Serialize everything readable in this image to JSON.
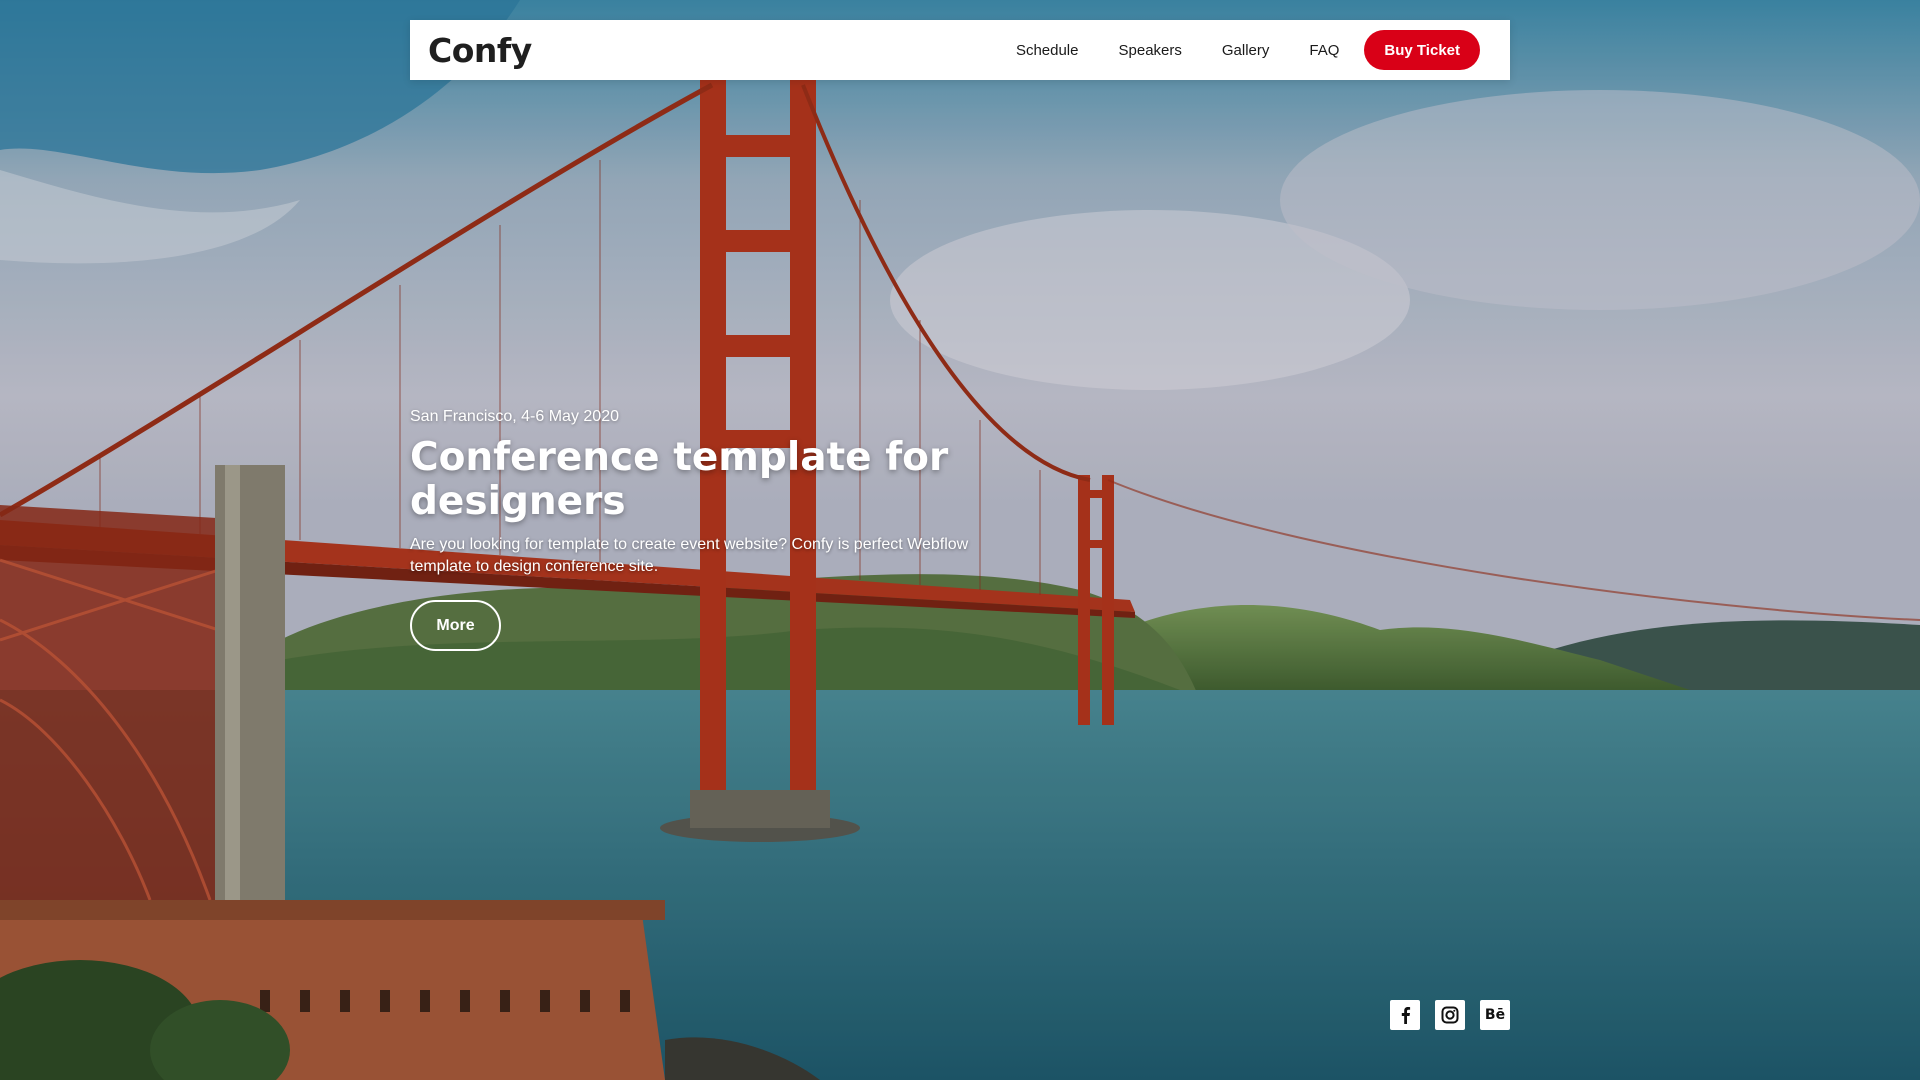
{
  "navbar": {
    "brand": "Confy",
    "links": [
      "Schedule",
      "Speakers",
      "Gallery",
      "FAQ"
    ],
    "cta_label": "Buy Ticket"
  },
  "hero": {
    "eyebrow": "San Francisco, 4-6 May 2020",
    "title": "Conference template for designers",
    "description": "Are you looking for template to create event website? Confy is perfect Webflow template to design conference site.",
    "more_label": "More",
    "background": "golden-gate-bridge-photo"
  },
  "socials": [
    {
      "name": "facebook-icon"
    },
    {
      "name": "instagram-icon"
    },
    {
      "name": "behance-icon",
      "label": "Bē"
    }
  ],
  "colors": {
    "accent": "#d90017",
    "navbar_bg": "#ffffff",
    "text_light": "#ffffff"
  }
}
